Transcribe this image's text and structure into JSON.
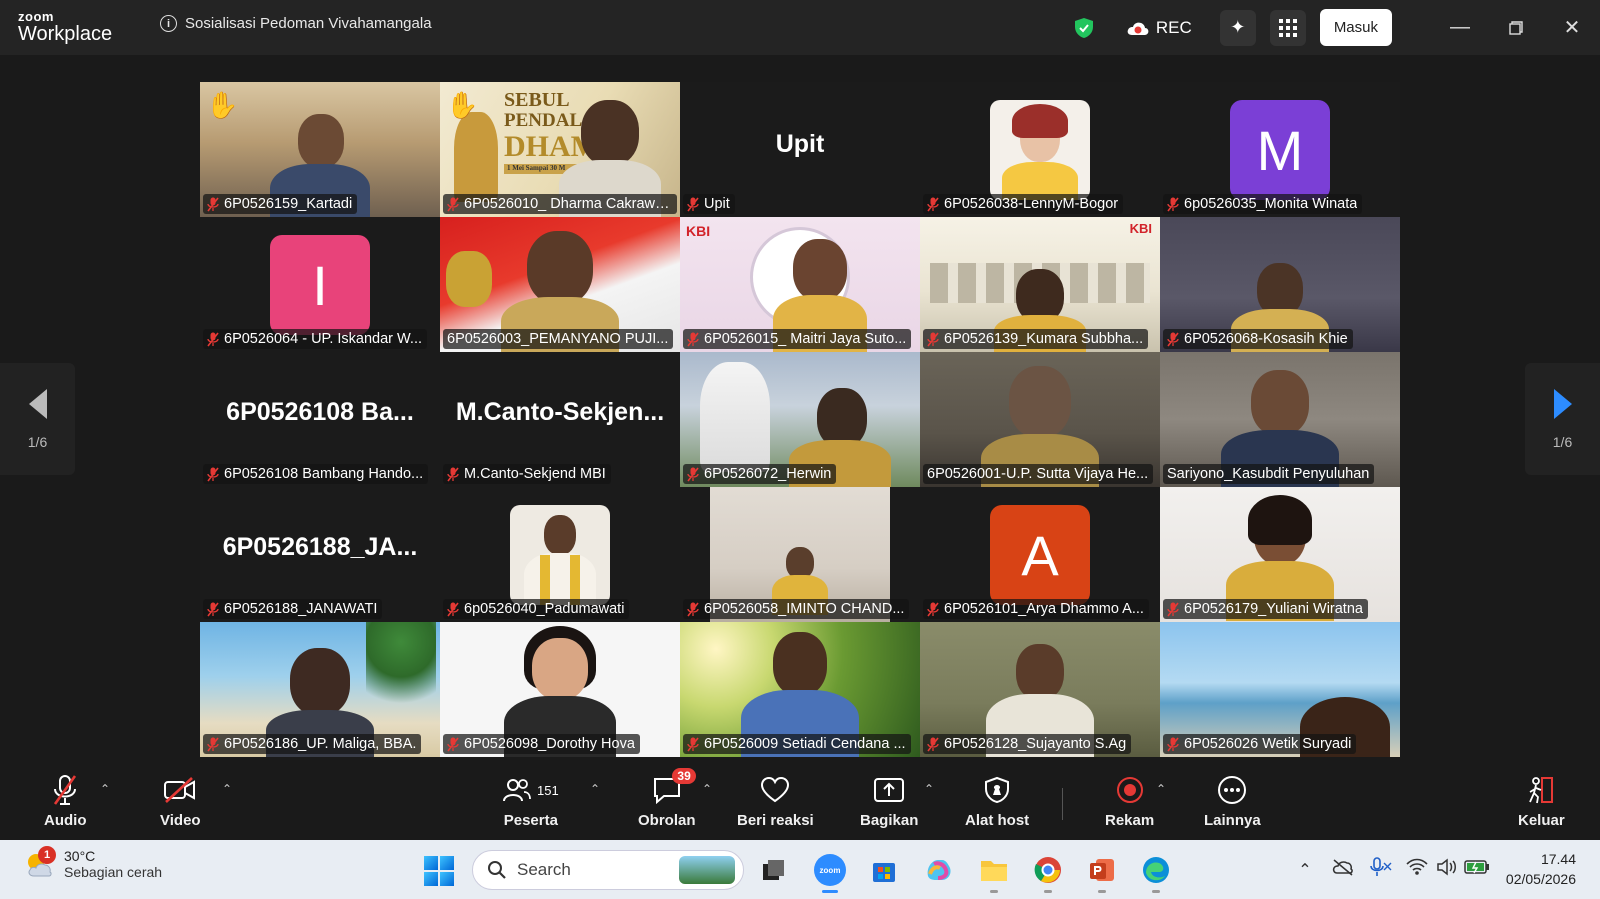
{
  "titlebar": {
    "logo_top": "zoom",
    "logo_bottom": "Workplace",
    "meeting_title": "Sosialisasi Pedoman Vivahamangala",
    "rec_label": "REC",
    "signin_label": "Masuk"
  },
  "gallery": {
    "page_left": "1/6",
    "page_right": "1/6",
    "tiles": [
      {
        "name": "6P0526159_Kartadi",
        "hand": true
      },
      {
        "name": "6P0526010_ Dharma Cakrawala",
        "hand": true
      },
      {
        "name": "Upit",
        "big": "Upit"
      },
      {
        "name": "6P0526038-LennyM-Bogor"
      },
      {
        "name": "6p0526035_Monita Winata",
        "initial": "M"
      },
      {
        "name": "6P0526064 - UP. Iskandar W...",
        "initial": "I"
      },
      {
        "name": "6P0526003_PEMANYANO PUJI..."
      },
      {
        "name": "6P0526015_ Maitri Jaya Suto..."
      },
      {
        "name": "6P0526139_Kumara Subbha..."
      },
      {
        "name": "6P0526068-Kosasih Khie"
      },
      {
        "name": "6P0526108 Bambang Hando...",
        "big": "6P0526108  Ba..."
      },
      {
        "name": "M.Canto-Sekjend MBI",
        "big": "M.Canto-Sekjen..."
      },
      {
        "name": "6P0526072_Herwin"
      },
      {
        "name": "6P0526001-U.P. Sutta Vijaya He..."
      },
      {
        "name": "Sariyono_Kasubdit Penyuluhan",
        "active": true
      },
      {
        "name": "6P0526188_JANAWATI",
        "big": "6P0526188_JA..."
      },
      {
        "name": "6p0526040_Padumawati"
      },
      {
        "name": "6P0526058_IMINTO CHAND..."
      },
      {
        "name": "6P0526101_Arya Dhammo A...",
        "initial": "A"
      },
      {
        "name": "6P0526179_Yuliani Wiratna"
      },
      {
        "name": "6P0526186_UP. Maliga, BBA."
      },
      {
        "name": "6P0526098_Dorothy Hova"
      },
      {
        "name": "6P0526009 Setiadi Cendana ..."
      },
      {
        "name": "6P0526128_Sujayanto S.Ag"
      },
      {
        "name": "6P0526026 Wetik Suryadi"
      }
    ],
    "tile2_banner_line1": "SEBUL",
    "tile2_banner_line2": "PENDAL",
    "tile2_banner_line3": "DHAM",
    "tile2_banner_small": "1 Mei Sampai 30 M",
    "tile8_logo": "KBI",
    "tile9_logo": "KBI"
  },
  "toolbar": {
    "audio": "Audio",
    "video": "Video",
    "participants": "Peserta",
    "participants_count": "151",
    "chat": "Obrolan",
    "chat_badge": "39",
    "react": "Beri reaksi",
    "share": "Bagikan",
    "host_tools": "Alat host",
    "record": "Rekam",
    "more": "Lainnya",
    "leave": "Keluar"
  },
  "taskbar": {
    "weather_badge": "1",
    "temperature": "30°C",
    "weather_desc": "Sebagian cerah",
    "search_placeholder": "Search",
    "time": "17.44",
    "date": "02/05/2026"
  },
  "colors": {
    "active_speaker": "#2fe87b",
    "avatar_m": "#7b3fd6",
    "avatar_i": "#e8437a",
    "avatar_a": "#d84315",
    "record_red": "#e53935"
  }
}
